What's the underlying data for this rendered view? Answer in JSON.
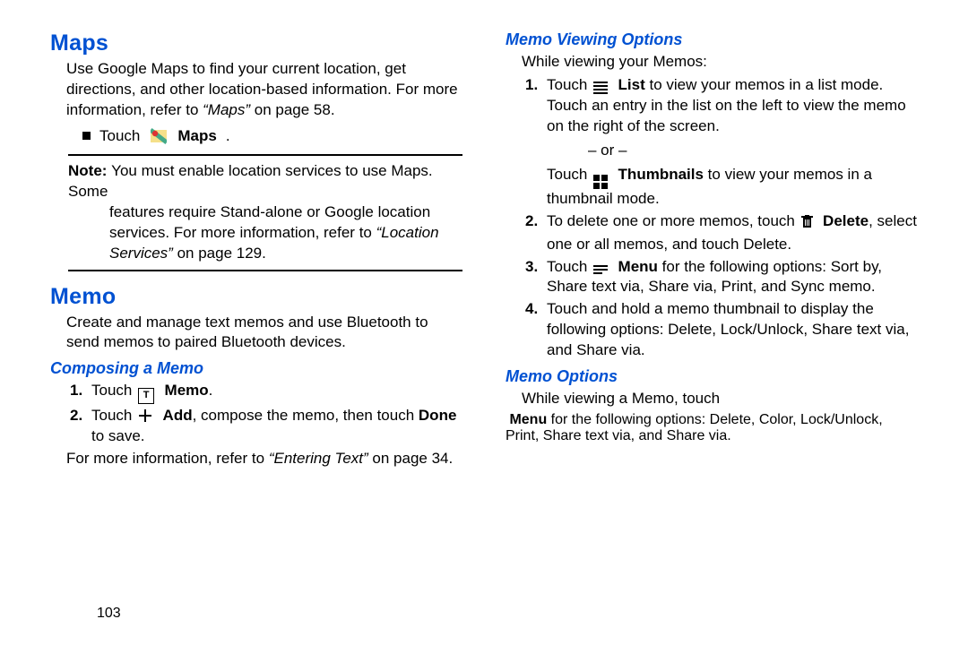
{
  "page_number": "103",
  "left": {
    "maps_heading": "Maps",
    "maps_body": "Use Google Maps to find your current location, get directions, and other location-based information. For more information, refer to ",
    "maps_ref": "“Maps”",
    "maps_ref_tail": " on page 58.",
    "touch_word": "Touch ",
    "maps_label": "Maps",
    "note_lead": "Note: ",
    "note_line1": "You must enable location services to use Maps. Some",
    "note_line2": "features require Stand-alone or Google location",
    "note_line3": "services. For more information, refer to ",
    "note_ref": "“Location Services”",
    "note_ref_tail": " on page 129.",
    "memo_heading": "Memo",
    "memo_body": "Create and manage text memos and use Bluetooth to send memos to paired Bluetooth devices.",
    "composing_heading": "Composing a Memo",
    "step1_pre": "Touch ",
    "step1_label": "Memo",
    "step2_pre": "Touch ",
    "step2_label": "Add",
    "step2_mid": ", compose the memo, then touch ",
    "step2_done": "Done",
    "step2_tail": " to save.",
    "more_info_pre": "For more information, refer to ",
    "more_info_ref": "“Entering Text”",
    "more_info_tail": " on page 34."
  },
  "right": {
    "viewing_heading": "Memo Viewing Options",
    "viewing_intro": "While viewing your Memos:",
    "v1_pre": "Touch ",
    "v1_list": "List",
    "v1_tail": " to view your memos in a list mode. Touch an entry in the list on the left to view the memo on the right of the screen.",
    "or_text": "– or –",
    "v1b_pre": "Touch ",
    "v1b_thumb": "Thumbnails",
    "v1b_tail": " to view your memos in a thumbnail mode.",
    "v2_pre": "To delete one or more memos, touch ",
    "v2_delete": "Delete",
    "v2_tail": ", select one or all memos, and touch Delete.",
    "v3_pre": "Touch ",
    "v3_menu": "Menu",
    "v3_tail": " for the following options: Sort by, Share text via, Share via, Print, and Sync memo.",
    "v4_text": "Touch and hold a memo thumbnail to display the following options: Delete, Lock/Unlock, Share text via, and Share via.",
    "options_heading": "Memo Options",
    "options_pre": "While viewing a Memo, touch ",
    "options_menu": "Menu",
    "options_tail": " for the following options: Delete, Color, Lock/Unlock, Print, Share text via, and Share via."
  }
}
